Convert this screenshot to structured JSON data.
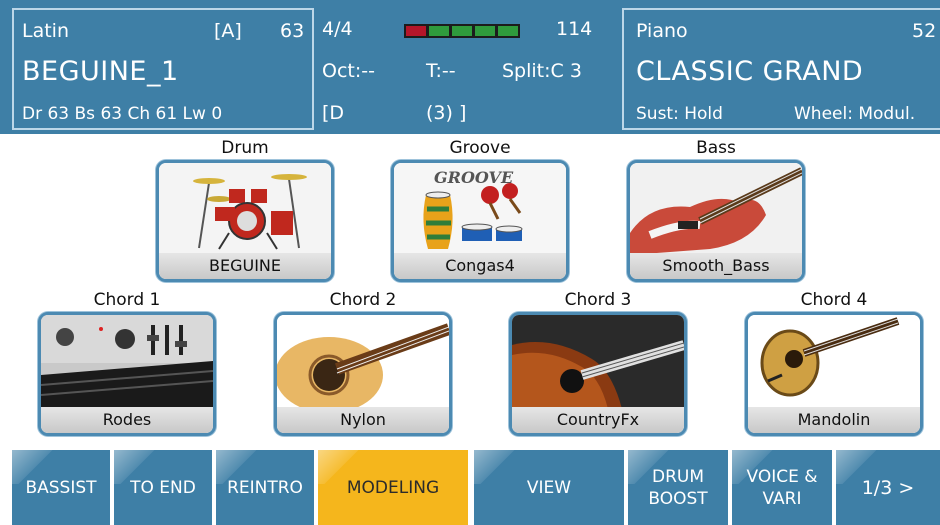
{
  "header": {
    "style": {
      "category": "Latin",
      "variation": "[A]",
      "volume": "63",
      "name": "BEGUINE_1",
      "mix": "Dr 63   Bs 63   Ch 61   Lw 0"
    },
    "status": {
      "meter": "4/4",
      "tempo": "114",
      "octave": "Oct:--",
      "transpose": "T:--",
      "split": "Split:C 3",
      "chord": "[D",
      "chord_extra": "(3) ]",
      "tempo_bar_colors": [
        "#b5162a",
        "#2f9b3d",
        "#2f9b3d",
        "#2f9b3d",
        "#2f9b3d"
      ]
    },
    "voice": {
      "category": "Piano",
      "volume": "52",
      "name": "CLASSIC GRAND",
      "sustain": "Sust: Hold",
      "wheel": "Wheel: Modul."
    }
  },
  "tiles": [
    {
      "label": "Drum",
      "name": "BEGUINE",
      "icon": "drum-kit-icon"
    },
    {
      "label": "Groove",
      "name": "Congas4",
      "icon": "congas-icon",
      "art_text": "GROOVE"
    },
    {
      "label": "Bass",
      "name": "Smooth_Bass",
      "icon": "bass-guitar-icon"
    },
    {
      "label": "Chord 1",
      "name": "Rodes",
      "icon": "electric-piano-icon"
    },
    {
      "label": "Chord 2",
      "name": "Nylon",
      "icon": "nylon-guitar-icon"
    },
    {
      "label": "Chord 3",
      "name": "CountryFx",
      "icon": "acoustic-guitar-icon"
    },
    {
      "label": "Chord 4",
      "name": "Mandolin",
      "icon": "mandolin-icon"
    }
  ],
  "buttons": [
    {
      "line1": "BASSIST",
      "line2": ""
    },
    {
      "line1": "TO END",
      "line2": ""
    },
    {
      "line1": "REINTRO",
      "line2": ""
    },
    {
      "line1": "MODELING",
      "line2": ""
    },
    {
      "line1": "VIEW",
      "line2": ""
    },
    {
      "line1": "DRUM",
      "line2": "BOOST"
    },
    {
      "line1": "VOICE &",
      "line2": "VARI"
    },
    {
      "line1": "1/3 >",
      "line2": ""
    }
  ],
  "colors": {
    "header_bg": "#3e7fa6",
    "active_button": "#f5b61c",
    "tile_border": "#4c8ab2"
  }
}
